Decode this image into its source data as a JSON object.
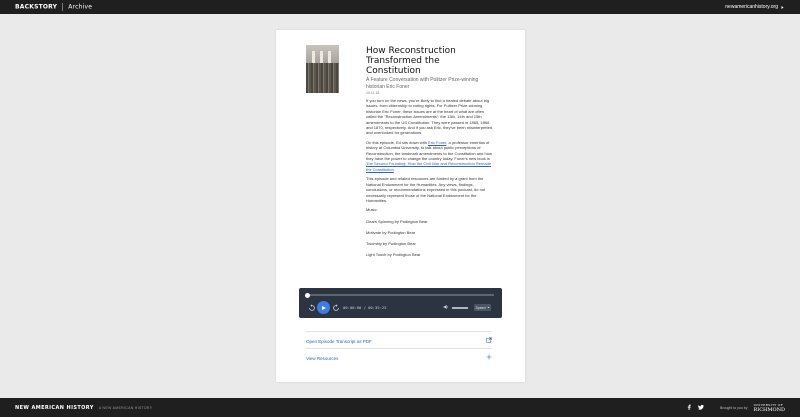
{
  "topbar": {
    "brand": "BACKSTORY",
    "section": "Archive",
    "site_link": "newamericanhistory.org",
    "site_icon": "arrow-right-icon"
  },
  "episode": {
    "title": "How Reconstruction Transformed the Constitution",
    "subtitle": "A Feature Conversation with Pulitzer Prize-winning historian Eric Foner",
    "date": "10.11.19",
    "para1": "If you turn on the news, you're likely to find a heated debate about big issues, from citizenship to voting rights. For Pulitzer Prize-winning historian Eric Foner, these issues are at the heart of what are often called the \"Reconstruction Amendments\": the 13th, 14th and 15th amendments to the US Constitution. They were passed in 1865, 1868 and 1870, respectively. And if you ask Eric, they've been misinterpreted and overlooked for generations.",
    "para2_a": "On this episode, Ed sits down with ",
    "para2_link": "Eric Foner",
    "para2_b": ", a professor emeritus of history at Columbia University, to talk about public perceptions of Reconstruction, the landmark amendments to the Constitution and how they have the power to change the country today. Foner's new book is ",
    "para2_book": "The Second Founding: How the Civil War and Reconstruction Remade the Constitution",
    "para2_c": ".",
    "para3": "This episode and related resources are funded by a grant from the National Endowment for the Humanities. Any views, findings, conclusions, or recommendations expressed in this podcast, do not necessarily represent those of the National Endowment for the Humanities.",
    "music_label": "Music:",
    "music": [
      "Gears Spinning by Podington Bear",
      "Motivate by Podington Bear",
      "Twombly by Podington Bear",
      "Light Touch by Podington Bear"
    ]
  },
  "player": {
    "time": "00:00:00 / 00:35:23",
    "speed": "Speed",
    "progress": 0,
    "icons": {
      "rewind": "rewind-15-icon",
      "play": "play-icon",
      "forward": "forward-15-icon",
      "volume": "volume-icon"
    }
  },
  "links": {
    "transcript": "Open Episode Transcript as PDF",
    "resources": "View Resources"
  },
  "footer": {
    "brand": "NEW AMERICAN HISTORY",
    "project": "A NEW AMERICAN HISTORY",
    "brought_by": "Brought to you by",
    "university_small": "UNIVERSITY OF",
    "university": "RICHMOND",
    "social": [
      "facebook-icon",
      "twitter-icon"
    ]
  },
  "colors": {
    "topbar": "#1f1f1f",
    "player": "#2b3440",
    "accent": "#2f63c8",
    "play_button": "#3d7de6"
  }
}
